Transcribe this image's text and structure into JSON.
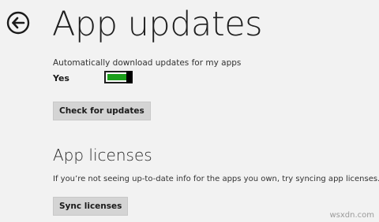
{
  "page": {
    "title": "App updates"
  },
  "auto_updates": {
    "label": "Automatically download updates for my apps",
    "state_text": "Yes",
    "toggle_on": true,
    "toggle_fill_fraction": 0.85,
    "accent_color": "#1a9e1a"
  },
  "actions": {
    "check_label": "Check for updates",
    "sync_label": "Sync licenses"
  },
  "licenses": {
    "title": "App licenses",
    "description": "If you’re not seeing up-to-date info for the apps you own, try syncing app licenses."
  },
  "icons": {
    "back": "back-arrow-icon"
  },
  "watermark": "wsxdn.com"
}
